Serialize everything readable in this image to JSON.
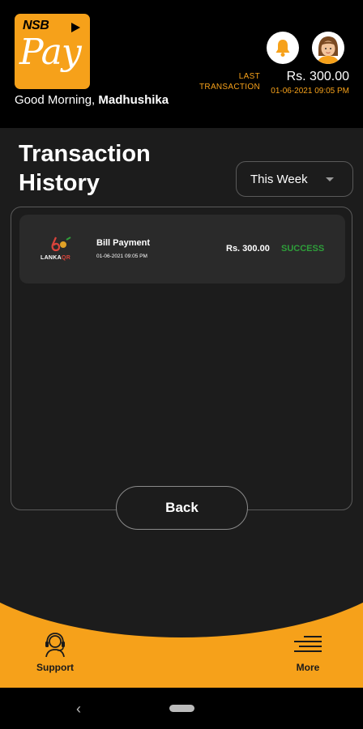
{
  "header": {
    "logo_brand": "NSB",
    "logo_product": "Pay",
    "greeting_prefix": "Good Morning,",
    "user_name": "Madhushika",
    "last_transaction_label_1": "LAST",
    "last_transaction_label_2": "TRANSACTION",
    "last_transaction_amount": "Rs. 300.00",
    "last_transaction_date": "01-06-2021 09:05 PM"
  },
  "main": {
    "title_line1": "Transaction",
    "title_line2": "History",
    "filter_selected": "This Week",
    "transactions": [
      {
        "merchant_logo_text": "LANKA",
        "merchant_logo_accent": "QR",
        "name": "Bill Payment",
        "date": "01-06-2021 09:05 PM",
        "amount": "Rs. 300.00",
        "status": "SUCCESS"
      }
    ],
    "back_label": "Back"
  },
  "bottom_nav": {
    "support_label": "Support",
    "more_label": "More"
  },
  "colors": {
    "accent": "#f6a11a",
    "success": "#2e9e3a",
    "background": "#1c1c1c"
  },
  "icons": {
    "notification": "bell-icon",
    "profile": "avatar",
    "support": "headset-icon",
    "more": "menu-lines-icon",
    "system_back": "chevron-left-icon",
    "system_home": "home-pill"
  }
}
